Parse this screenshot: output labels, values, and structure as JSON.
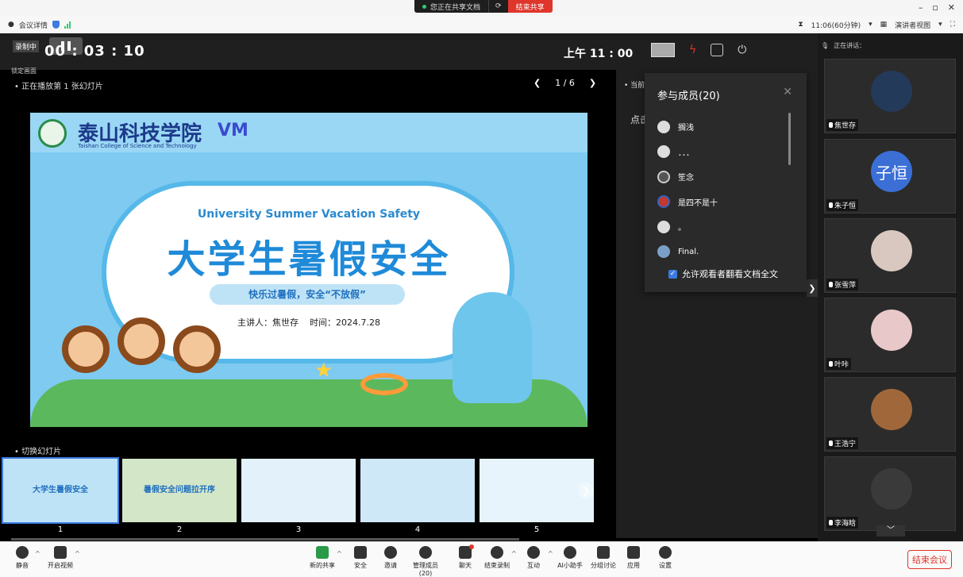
{
  "share_banner": {
    "status": "您正在共享文档",
    "end": "结束共享"
  },
  "window": {
    "min": "–",
    "max": "▫",
    "close": "✕"
  },
  "infobar": {
    "meeting_details": "会议详情",
    "time_info": "11:06(60分钟)",
    "view_mode": "演讲者视图"
  },
  "topbar": {
    "timer": "00 : 03 : 10",
    "rec_label": "录制中",
    "lock_label": "锁定画面",
    "clock": "上午 11 : 00"
  },
  "slide_header": {
    "now_playing": "• 正在播放第 1 张幻灯片",
    "page": "1 / 6"
  },
  "slide": {
    "school_cn": "泰山科技学院",
    "school_en": "Taishan College of Science and Technology",
    "title_en": "University Summer Vacation Safety",
    "title_cn": "大学生暑假安全",
    "tagline": "快乐过暑假，安全“不放假”",
    "speaker": "主讲人：焦世存",
    "date": "时间：2024.7.28"
  },
  "switch": {
    "label": "• 切换幻灯片",
    "thumbs": [
      {
        "num": "1",
        "title": "大学生暑假安全"
      },
      {
        "num": "2",
        "title": "暑假安全问题拉开序"
      },
      {
        "num": "3",
        "title": ""
      },
      {
        "num": "4",
        "title": ""
      },
      {
        "num": "5",
        "title": ""
      }
    ]
  },
  "right_panel": {
    "current": "• 当前",
    "click_hint": "点击"
  },
  "members": {
    "header": "参与成员(20)",
    "list": [
      {
        "name": "搁浅"
      },
      {
        "name": "．．．"
      },
      {
        "name": "笙念"
      },
      {
        "name": "是四不是十"
      },
      {
        "name": "。"
      },
      {
        "name": "Final."
      }
    ],
    "allow": "允许观看者翻看文档全文"
  },
  "video": {
    "speaking": "正在讲话：",
    "tiles": [
      {
        "name": "焦世存"
      },
      {
        "name": "朱子恒",
        "avatar_text": "子恒"
      },
      {
        "name": "张雪萍"
      },
      {
        "name": "叶咔"
      },
      {
        "name": "王浩宁"
      },
      {
        "name": "李海晗"
      }
    ]
  },
  "toolbar": {
    "mute": "静音",
    "video": "开启视频",
    "new_share": "新的共享",
    "security": "安全",
    "invite": "邀请",
    "members": "管理成员(20)",
    "chat": "聊天",
    "end_record": "结束录制",
    "interact": "互动",
    "ai": "AI小助手",
    "breakout": "分组讨论",
    "apps": "应用",
    "settings": "设置",
    "end_meeting": "结束会议"
  }
}
